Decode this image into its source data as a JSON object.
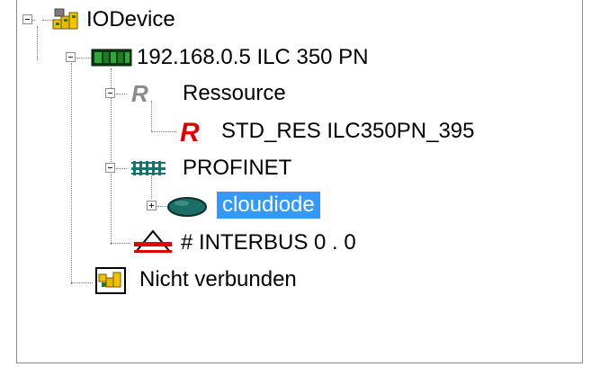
{
  "tree": {
    "root": {
      "label": "IODevice",
      "icon": "io-device-icon"
    },
    "device": {
      "label": "192.168.0.5 ILC 350 PN",
      "icon": "controller-module-icon"
    },
    "ressource": {
      "label": "Ressource",
      "icon": "resource-r-gray-icon"
    },
    "std_res": {
      "label": "STD_RES ILC350PN_395",
      "icon": "resource-r-red-icon"
    },
    "profinet": {
      "label": "PROFINET",
      "icon": "profinet-bus-icon"
    },
    "cloudiode": {
      "label": "cloudiode",
      "icon": "network-device-icon",
      "selected": true
    },
    "interbus": {
      "label": "# INTERBUS 0 . 0",
      "icon": "interbus-warning-icon"
    },
    "nicht_verbunden": {
      "label": "Nicht verbunden",
      "icon": "unconnected-icon"
    }
  },
  "colors": {
    "selection": "#3399ff",
    "resource_red": "#e00000",
    "resource_gray": "#8a8a8a",
    "profinet_teal": "#1f6f6a"
  }
}
